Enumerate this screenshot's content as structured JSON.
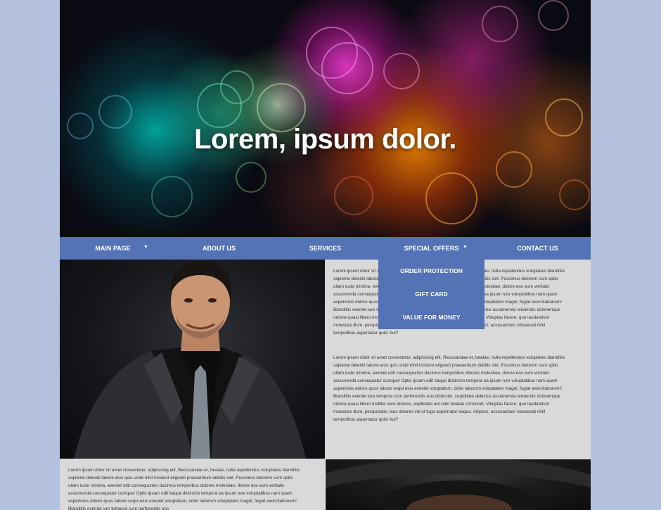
{
  "hero": {
    "title": "Lorem, ipsum dolor."
  },
  "nav": {
    "items": [
      {
        "label": "MAIN PAGE",
        "has_dropdown": true
      },
      {
        "label": "ABOUT US",
        "has_dropdown": false
      },
      {
        "label": "SERVICES",
        "has_dropdown": false
      },
      {
        "label": "SPECIAL OFFERS",
        "has_dropdown": true
      },
      {
        "label": "CONTACT US",
        "has_dropdown": false
      }
    ],
    "dropdown": [
      "ORDER PROTECTION",
      "GIFT CARD",
      "VALUE FOR MONEY"
    ],
    "caret_icon": "caret-down-icon"
  },
  "content": {
    "paragraph_1": "Lorem ipsum dolor sit amet consectetur, adipisicing elit. Recusandae et, beatae, nulla repellendus voluptates blanditiis sapiente deleniti labore eius quis unde nihil incidunt eligendi praesentium debitis sint. Possimus dolorem sunt optio ullam iusto minima, eveniet odit consequuntur ducimus temporibus dolores molestiae, dolore eos eum veritatis assumenda consequatur cumque! Optio ipsam odit itaque distinctio tempora ea ipsum iure voluptatibus nam quam asperiores dolore quos labore sequi eius eveniet voluptatum, dolor laborum voluptatem magni, fugiat exercitationem! Blanditiis eveniet iure tempora cum perferendis eos distinctio, cupiditate delectus assumenda reiciendis doloremque ratione quasi libero mollitia vero dolores, explicabo aut odio beatae commodi. Voluptas facere, quo laudantium molestias illum, perspiciatis, eius dolores vel ut fuga aspernatur eaque. Adipisci, accusantium obcaecati nihil temporibus aspernatur quis! Aut?",
    "paragraph_2": "Lorem ipsum dolor sit amet consectetur, adipisicing elit. Recusandae et, beatae, nulla repellendus voluptates blanditiis sapiente deleniti labore eius quis unde nihil incidunt eligendi praesentium debitis sint. Possimus dolorem sunt optio ullam iusto minima, eveniet odit consequuntur ducimus temporibus dolores molestiae, dolore eos eum veritatis assumenda consequatur cumque! Optio ipsam odit itaque distinctio tempora ea ipsum iure voluptatibus nam quam asperiores dolore quos labore sequi eius eveniet voluptatum, dolor laborum voluptatem magni, fugiat exercitationem! Blanditiis eveniet iure tempora cum perferendis eos distinctio, cupiditate delectus assumenda reiciendis doloremque ratione quasi libero mollitia vero dolores, explicabo aut odio beatae commodi. Voluptas facere, quo laudantium molestias illum, perspiciatis, eius dolores vel ut fuga aspernatur eaque. Adipisci, accusantium obcaecati nihil temporibus aspernatur quis! Aut?",
    "paragraph_3": "Lorem ipsum dolor sit amet consectetur, adipisicing elit. Recusandae et, beatae, nulla repellendus voluptates blanditiis sapiente deleniti labore eius quis unde nihil incidunt eligendi praesentium debitis sint. Possimus dolorem sunt optio ullam iusto minima, eveniet odit consequuntur ducimus temporibus dolores molestiae, dolore eos eum veritatis assumenda consequatur cumque! Optio ipsam odit itaque distinctio tempora ea ipsum iure voluptatibus nam quam asperiores dolore quos labore sequi eius eveniet voluptatum, dolor laborum voluptatem magni, fugiat exercitationem! Blanditiis eveniet iure tempora cum perferendis eos"
  },
  "colors": {
    "background": "#b5c2df",
    "nav": "#5472b6",
    "content": "#d9d9d9"
  }
}
